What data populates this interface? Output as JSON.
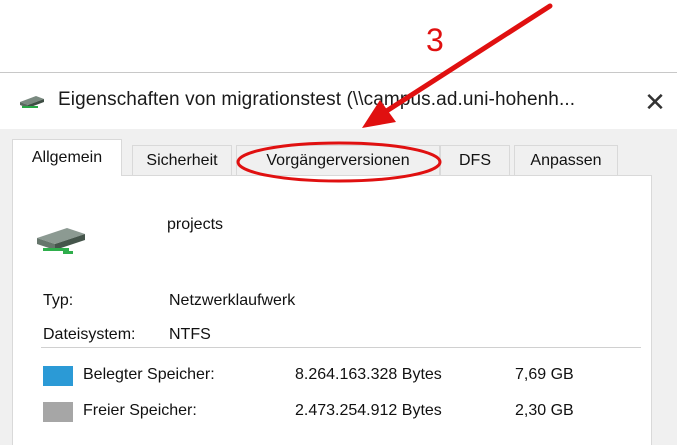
{
  "window": {
    "title": "Eigenschaften von migrationstest (\\\\campus.ad.uni-hohenh...",
    "close_glyph": "✕"
  },
  "tabs": [
    {
      "label": "Allgemein",
      "active": true
    },
    {
      "label": "Sicherheit",
      "active": false
    },
    {
      "label": "Vorgängerversionen",
      "active": false
    },
    {
      "label": "DFS",
      "active": false
    },
    {
      "label": "Anpassen",
      "active": false
    }
  ],
  "general": {
    "drive_icon": "network-drive-icon",
    "name": "projects",
    "type_label": "Typ:",
    "type_value": "Netzwerklaufwerk",
    "fs_label": "Dateisystem:",
    "fs_value": "NTFS"
  },
  "storage": [
    {
      "label": "Belegter Speicher:",
      "bytes": "8.264.163.328 Bytes",
      "size": "7,69 GB",
      "color": "#2b9ad6"
    },
    {
      "label": "Freier Speicher:",
      "bytes": "2.473.254.912 Bytes",
      "size": "2,30 GB",
      "color": "#a6a6a6"
    }
  ],
  "annotation": {
    "step_label": "3",
    "color": "#e01010"
  }
}
